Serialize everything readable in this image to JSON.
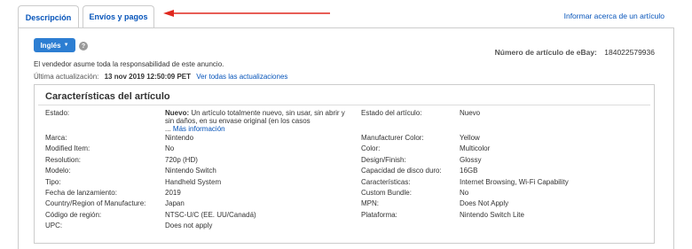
{
  "tabs": [
    {
      "label": "Descripción"
    },
    {
      "label": "Envíos y pagos"
    }
  ],
  "report_link": "Informar acerca de un artículo",
  "language_button": "Inglés",
  "item_number_label": "Número de artículo de eBay:",
  "item_number": "184022579936",
  "seller_note": "El vendedor asume toda la responsabilidad de este anuncio.",
  "last_update": {
    "label": "Última actualización:",
    "date": "13 nov 2019 12:50:09 PET",
    "link": "Ver todas las actualizaciones"
  },
  "specs": {
    "title": "Características del artículo",
    "condition": {
      "label": "Estado:",
      "value_bold": "Nuevo:",
      "value_text": "Un artículo totalmente nuevo, sin usar, sin abrir y sin daños, en su envase original (en los casos",
      "ellipsis": "...",
      "more": "Más información"
    },
    "left_rows": [
      {
        "label": "Marca:",
        "value": "Nintendo"
      },
      {
        "label": "Modified Item:",
        "value": "No"
      },
      {
        "label": "Resolution:",
        "value": "720p (HD)"
      },
      {
        "label": "Modelo:",
        "value": "Nintendo Switch"
      },
      {
        "label": "Tipo:",
        "value": "Handheld System"
      },
      {
        "label": "Fecha de lanzamiento:",
        "value": "2019"
      },
      {
        "label": "Country/Region of Manufacture:",
        "value": "Japan"
      },
      {
        "label": "Código de región:",
        "value": "NTSC-U/C (EE. UU/Canadá)"
      },
      {
        "label": "UPC:",
        "value": "Does not apply"
      }
    ],
    "right_top": {
      "label": "Estado del artículo:",
      "value": "Nuevo"
    },
    "right_rows": [
      {
        "label": "Manufacturer Color:",
        "value": "Yellow"
      },
      {
        "label": "Color:",
        "value": "Multicolor"
      },
      {
        "label": "Design/Finish:",
        "value": "Glossy"
      },
      {
        "label": "Capacidad de disco duro:",
        "value": "16GB"
      },
      {
        "label": "Características:",
        "value": "Internet Browsing, Wi-Fi Capability"
      },
      {
        "label": "Custom Bundle:",
        "value": "No"
      },
      {
        "label": "MPN:",
        "value": "Does Not Apply"
      },
      {
        "label": "Plataforma:",
        "value": "Nintendo Switch Lite"
      }
    ]
  },
  "colors": {
    "accent": "#0654ba",
    "button": "#2d7ed2",
    "annotation_arrow": "#e0281e"
  }
}
